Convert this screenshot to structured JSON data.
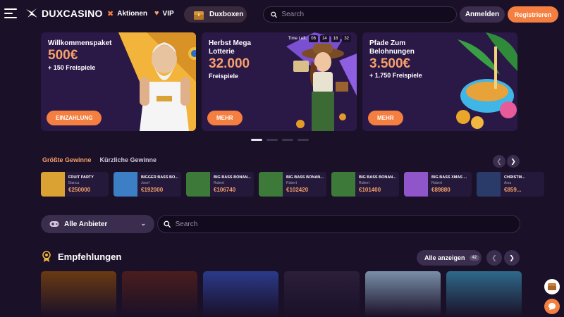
{
  "header": {
    "brand": "DUXCASINO",
    "nav": [
      {
        "label": "Aktionen",
        "icon": "tag-icon"
      },
      {
        "label": "VIP",
        "icon": "heart-icon"
      }
    ],
    "duxboxen_label": "Duxboxen",
    "search_placeholder": "Search",
    "login_label": "Anmelden",
    "register_label": "Registrieren"
  },
  "banners": [
    {
      "title": "Willkommenspaket",
      "amount": "500€",
      "sub_plus": "+ 150",
      "sub_rest": " Freispiele",
      "button": "EINZAHLUNG"
    },
    {
      "title_line1": "Herbst Mega",
      "title_line2": "Lotterie",
      "amount": "32.000",
      "sub": "Freispiele",
      "button": "MEHR",
      "timer_label": "Time Left:",
      "timer": [
        "06",
        "14",
        "18",
        "32"
      ]
    },
    {
      "title_line1": "Pfade Zum",
      "title_line2": "Belohnungen",
      "amount": "3.500€",
      "sub": "+ 1.750 Freispiele",
      "button": "MEHR"
    }
  ],
  "wins": {
    "tab_active": "Größte Gewinne",
    "tab_inactive": "Kürzliche Gewinne",
    "items": [
      {
        "game": "FRUIT PARTY",
        "user": "Bianca",
        "amount": "€250000",
        "color": "#d9a233"
      },
      {
        "game": "BIGGER BASS BO...",
        "user": "Josef",
        "amount": "€192000",
        "color": "#3c7fc4"
      },
      {
        "game": "BIG BASS BONAN...",
        "user": "Robert",
        "amount": "€106740",
        "color": "#3d7a3a"
      },
      {
        "game": "BIG BASS BONAN...",
        "user": "Robert",
        "amount": "€102420",
        "color": "#3d7a3a"
      },
      {
        "game": "BIG BASS BONAN...",
        "user": "Robert",
        "amount": "€101400",
        "color": "#3d7a3a"
      },
      {
        "game": "BIG BASS XMAS ...",
        "user": "Robert",
        "amount": "€89880",
        "color": "#8f55c9"
      },
      {
        "game": "CHRISTM...",
        "user": "Arzu",
        "amount": "€859...",
        "color": "#2a3b6a"
      }
    ]
  },
  "filter": {
    "provider_label": "Alle Anbieter",
    "search_placeholder": "Search"
  },
  "recommendations": {
    "title": "Empfehlungen",
    "show_all_label": "Alle anzeigen",
    "count": "42",
    "tiles": [
      {
        "color": "#6a3a12"
      },
      {
        "color": "#4a1d1d"
      },
      {
        "color": "#2b3a8a"
      },
      {
        "color": "#2b1f3a"
      },
      {
        "color": "#7a8fa8"
      },
      {
        "color": "#2e6a8a"
      }
    ]
  },
  "colors": {
    "accent": "#f47f40",
    "accent_text": "#f6a06a",
    "bg": "#1a1028",
    "panel": "#2a1847"
  }
}
